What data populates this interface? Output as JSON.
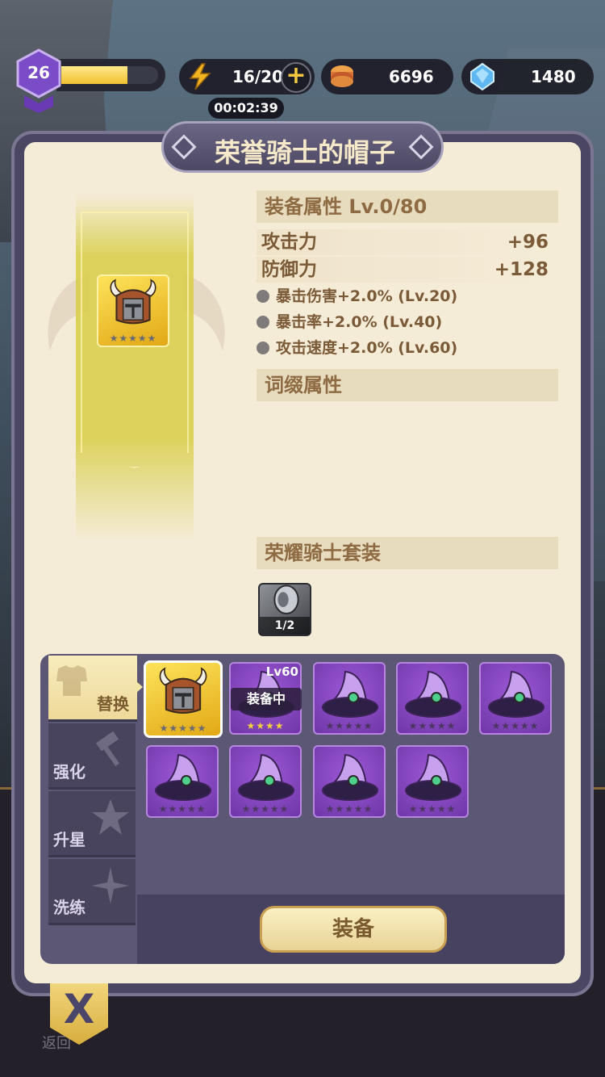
{
  "topbar": {
    "level": "26",
    "xp_progress": 0.68,
    "energy": "16/20",
    "energy_timer": "00:02:39",
    "gold": "6696",
    "gems": "1480"
  },
  "item": {
    "name": "荣誉骑士的帽子",
    "stars": "★★★★★"
  },
  "equip_attributes": {
    "header": "装备属性 Lv.0/80",
    "stats": [
      {
        "label": "攻击力",
        "value": "+96"
      },
      {
        "label": "防御力",
        "value": "+128"
      }
    ],
    "bonuses": [
      "暴击伤害+2.0% (Lv.20)",
      "暴击率+2.0% (Lv.40)",
      "攻击速度+2.0% (Lv.60)"
    ]
  },
  "affix": {
    "header": "词缀属性"
  },
  "set": {
    "header": "荣耀骑士套装",
    "count": "1/2"
  },
  "tabs": [
    {
      "label": "替换",
      "icon": "armor-icon"
    },
    {
      "label": "强化",
      "icon": "hammer-icon"
    },
    {
      "label": "升星",
      "icon": "star-icon"
    },
    {
      "label": "洗练",
      "icon": "sparkle-icon"
    }
  ],
  "inventory": {
    "selected_stars": "★★★★★",
    "equipped_level": "Lv60",
    "equipped_tag": "装备中",
    "equipped_stars": "★★★★",
    "hat_stars": "★★★★★"
  },
  "buttons": {
    "equip": "装备",
    "close": "X",
    "back": "返回"
  }
}
